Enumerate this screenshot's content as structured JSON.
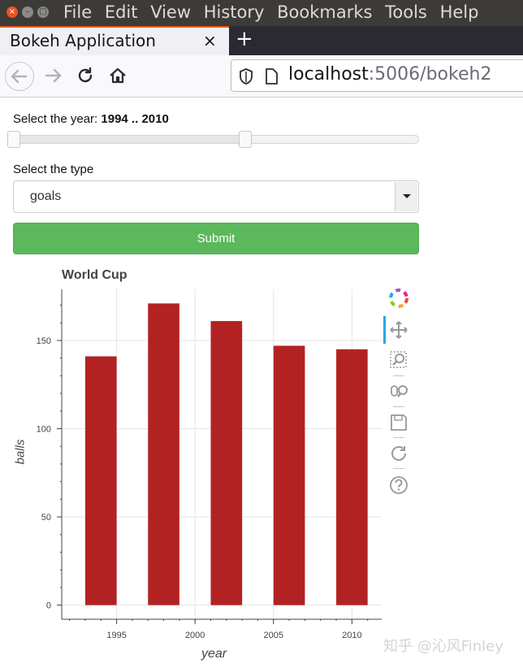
{
  "window": {
    "menu_items": [
      "File",
      "Edit",
      "View",
      "History",
      "Bookmarks",
      "Tools",
      "Help"
    ],
    "controls": {
      "close": "×",
      "minimize": "–",
      "maximize": "□"
    }
  },
  "tabs": [
    {
      "title": "Bokeh Application",
      "close_glyph": "×"
    }
  ],
  "new_tab_glyph": "+",
  "navbar": {
    "url_host": "localhost",
    "url_path": ":5006/bokeh2"
  },
  "slider": {
    "label": "Select the year: ",
    "value_text": "1994 .. 2010",
    "range": [
      1994,
      2010
    ],
    "start_fraction": 0.0,
    "end_fraction": 0.57
  },
  "select": {
    "label": "Select the type",
    "value": "goals"
  },
  "submit_label": "Submit",
  "chart_data": {
    "type": "bar",
    "title": "World Cup",
    "xlabel": "year",
    "ylabel": "balls",
    "x": [
      1994,
      1998,
      2002,
      2006,
      2010
    ],
    "values": [
      141,
      171,
      161,
      147,
      145
    ],
    "bar_width_years": 2,
    "xlim": [
      1991.5,
      2012
    ],
    "ylim": [
      -8,
      179
    ],
    "xticks": [
      1995,
      2000,
      2005,
      2010
    ],
    "yticks": [
      0,
      50,
      100,
      150
    ],
    "grid": true,
    "bar_color": "#b22222"
  },
  "toolbar": {
    "icons": [
      "bokeh-logo-icon",
      "pan-icon",
      "box-zoom-icon",
      "wheel-zoom-icon",
      "save-icon",
      "reset-icon",
      "help-icon"
    ]
  },
  "watermark": "知乎 @沁风Finley"
}
